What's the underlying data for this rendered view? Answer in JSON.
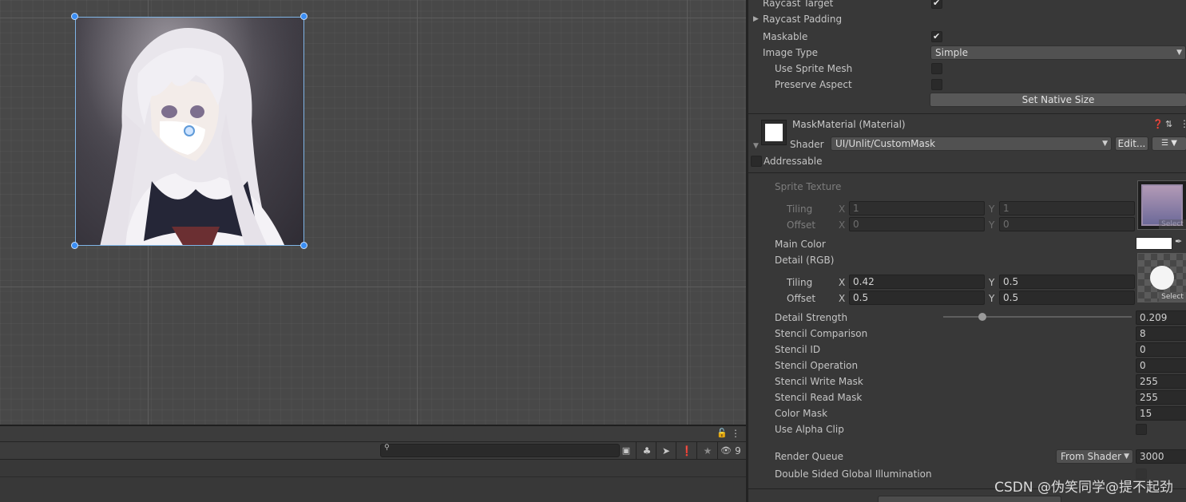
{
  "scene": {
    "image_label": "anime character image (white-haired girl in sailor uniform)"
  },
  "console": {
    "search_placeholder": "",
    "hidden_count": "9"
  },
  "inspector": {
    "image_component": {
      "raycast_target_label": "Raycast Target",
      "raycast_target_checked": true,
      "raycast_padding_label": "Raycast Padding",
      "maskable_label": "Maskable",
      "maskable_checked": true,
      "image_type_label": "Image Type",
      "image_type_value": "Simple",
      "use_sprite_mesh_label": "Use Sprite Mesh",
      "use_sprite_mesh_checked": false,
      "preserve_aspect_label": "Preserve Aspect",
      "preserve_aspect_checked": false,
      "set_native_size_label": "Set Native Size"
    },
    "material": {
      "title": "MaskMaterial (Material)",
      "shader_label": "Shader",
      "shader_value": "UI/Unlit/CustomMask",
      "edit_label": "Edit...",
      "addressable_label": "Addressable"
    },
    "properties": {
      "sprite_texture_label": "Sprite Texture",
      "sprite_tiling_label": "Tiling",
      "sprite_offset_label": "Offset",
      "sprite_tiling_x": "1",
      "sprite_tiling_y": "1",
      "sprite_offset_x": "0",
      "sprite_offset_y": "0",
      "main_color_label": "Main Color",
      "main_color_value": "#ffffff",
      "detail_label": "Detail (RGB)",
      "detail_tiling_label": "Tiling",
      "detail_offset_label": "Offset",
      "detail_tiling_x": "0.42",
      "detail_tiling_y": "0.5",
      "detail_offset_x": "0.5",
      "detail_offset_y": "0.5",
      "axis_x": "X",
      "axis_y": "Y",
      "select_label": "Select",
      "detail_strength_label": "Detail Strength",
      "detail_strength_value": "0.209",
      "detail_strength_fraction": 0.209,
      "stencil_comparison_label": "Stencil Comparison",
      "stencil_comparison_value": "8",
      "stencil_id_label": "Stencil ID",
      "stencil_id_value": "0",
      "stencil_operation_label": "Stencil Operation",
      "stencil_operation_value": "0",
      "stencil_write_mask_label": "Stencil Write Mask",
      "stencil_write_mask_value": "255",
      "stencil_read_mask_label": "Stencil Read Mask",
      "stencil_read_mask_value": "255",
      "color_mask_label": "Color Mask",
      "color_mask_value": "15",
      "use_alpha_clip_label": "Use Alpha Clip",
      "use_alpha_clip_checked": false,
      "render_queue_label": "Render Queue",
      "render_queue_source": "From Shader",
      "render_queue_value": "3000",
      "double_sided_gi_label": "Double Sided Global Illumination"
    }
  },
  "watermark": "CSDN @伪笑同学@提不起劲"
}
